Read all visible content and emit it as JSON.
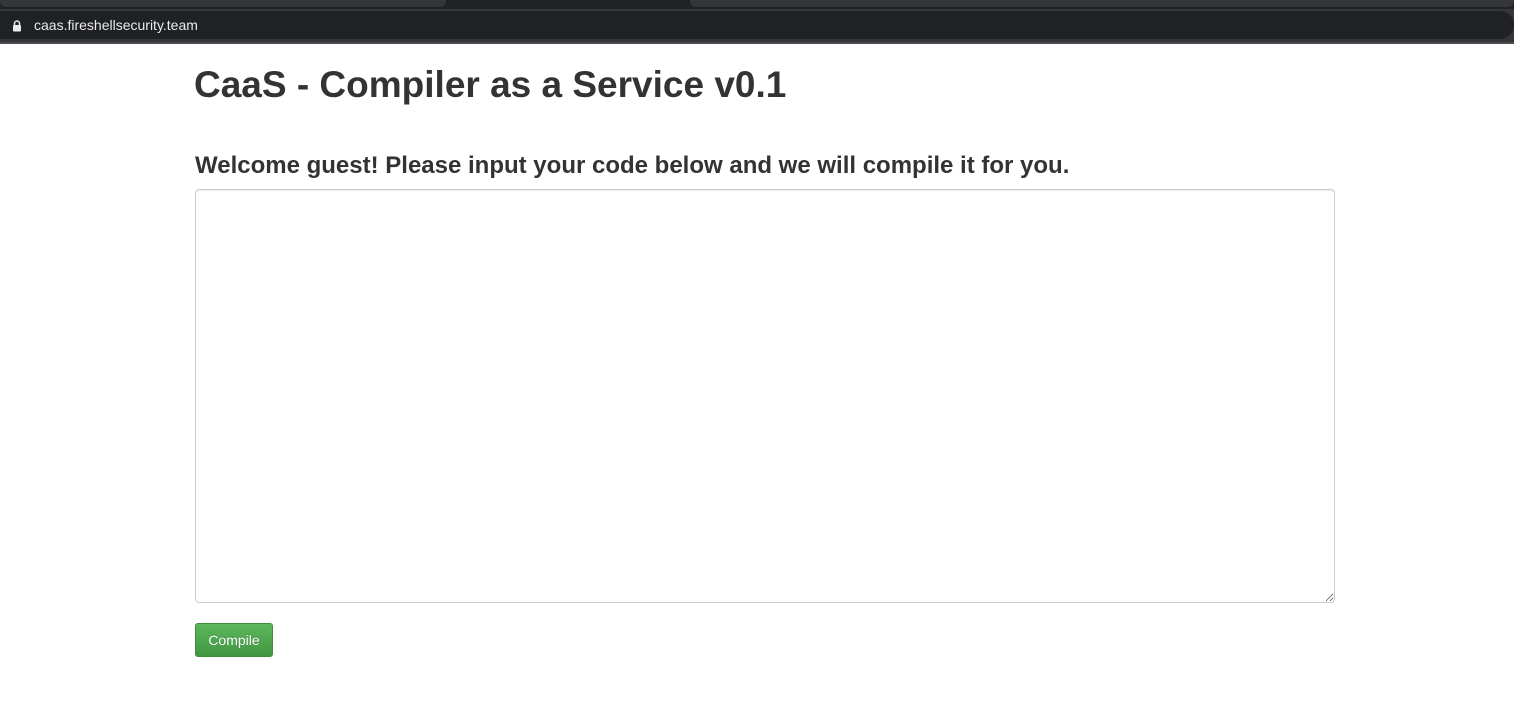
{
  "browser": {
    "url": "caas.fireshellsecurity.team",
    "lock_icon": "lock-icon"
  },
  "page": {
    "title": "CaaS - Compiler as a Service v0.1",
    "welcome": "Welcome guest! Please input your code below and we will compile it for you.",
    "code_input": {
      "value": "",
      "placeholder": ""
    },
    "compile_button": "Compile"
  },
  "colors": {
    "button_green": "#5cb85c",
    "text_dark": "#333333",
    "browser_chrome": "#202124"
  }
}
